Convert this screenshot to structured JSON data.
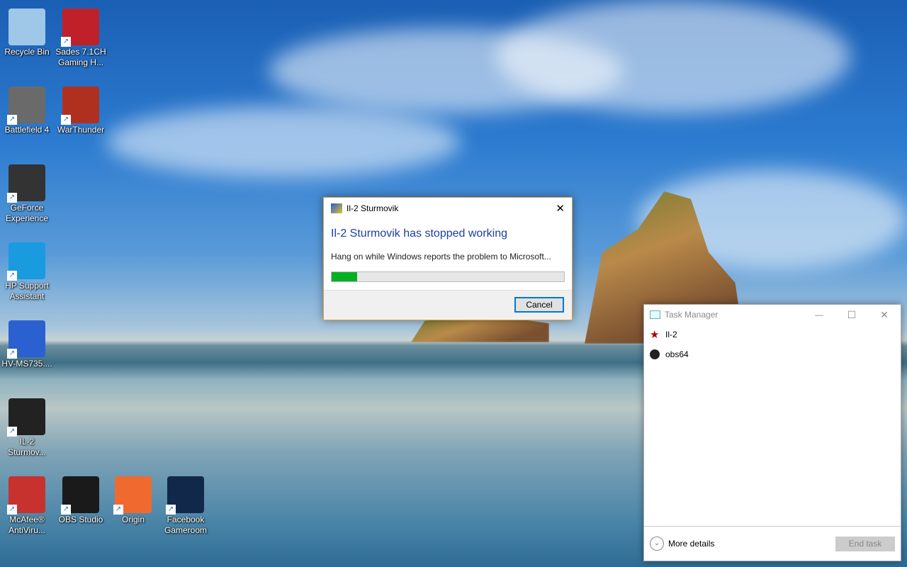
{
  "desktop_icons": [
    {
      "label": "Recycle Bin",
      "icon": "recycle-bin-icon",
      "color": "#9fc7e8"
    },
    {
      "label": "Sades 7.1CH Gaming H...",
      "icon": "sades-icon",
      "color": "#c0202a"
    },
    {
      "label": "Battlefield 4",
      "icon": "battlefield-icon",
      "color": "#6a6a6a"
    },
    {
      "label": "WarThunder",
      "icon": "warthunder-icon",
      "color": "#b03020"
    },
    {
      "label": "GeForce Experience",
      "icon": "geforce-icon",
      "color": "#333333"
    },
    {
      "label": "HP Support Assistant",
      "icon": "help-icon",
      "color": "#1a9be0"
    },
    {
      "label": "HV-MS735....",
      "icon": "mouse-app-icon",
      "color": "#2a60d0"
    },
    {
      "label": "IL-2 Sturmov...",
      "icon": "il2-icon",
      "color": "#222222"
    },
    {
      "label": "McAfee® AntiViru...",
      "icon": "mcafee-icon",
      "color": "#c8322e"
    },
    {
      "label": "OBS Studio",
      "icon": "obs-icon",
      "color": "#1a1a1a"
    },
    {
      "label": "Origin",
      "icon": "origin-icon",
      "color": "#f06a30"
    },
    {
      "label": "Facebook Gameroom",
      "icon": "gameroom-icon",
      "color": "#12284a"
    }
  ],
  "dialog": {
    "title": "Il-2 Sturmovik",
    "heading": "Il-2 Sturmovik has stopped working",
    "message": "Hang on while Windows reports the problem to Microsoft...",
    "progress_percent": 11,
    "cancel_label": "Cancel",
    "close": "✕",
    "accent": "#0b7a2c"
  },
  "task_manager": {
    "title": "Task Manager",
    "minimize": "—",
    "maximize": "☐",
    "close": "✕",
    "apps": [
      {
        "name": "Il-2",
        "icon": "star-icon"
      },
      {
        "name": "obs64",
        "icon": "obs-icon"
      }
    ],
    "more_details": "More details",
    "end_task": "End task"
  }
}
